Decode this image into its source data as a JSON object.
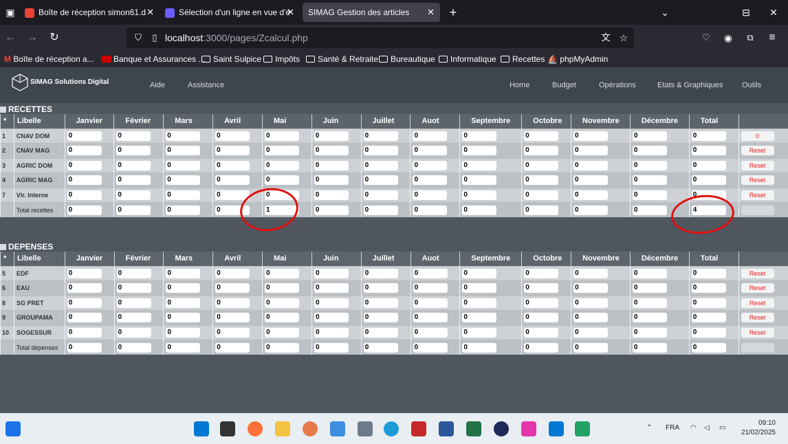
{
  "browser": {
    "tabs": [
      {
        "label": "Boîte de réception    simon61.d",
        "active": false
      },
      {
        "label": "Sélection d'un ligne en vue d'é",
        "active": false
      },
      {
        "label": "SIMAG Gestion des articles",
        "active": true
      }
    ],
    "url_host": "localhost",
    "url_path": ":3000/pages/Zcalcul.php",
    "bookmarks": [
      "Boîte de réception",
      "a...",
      "Banque et Assurances ...",
      "Saint Sulpice",
      "Impôts",
      "Santé & Retraite",
      "Bureautique",
      "Informatique",
      "Recettes",
      "phpMyAdmin"
    ]
  },
  "app": {
    "brand": "SIMAG Solutions Digital",
    "menu_left": [
      "Aide",
      "Assistance"
    ],
    "menu_right": [
      "Home",
      "Budget",
      "Opérations",
      "Etats & Graphiques",
      "Outils"
    ]
  },
  "columns": [
    "*",
    "Libelle",
    "Janvier",
    "Février",
    "Mars",
    "Avril",
    "Mai",
    "Juin",
    "Juillet",
    "Auot",
    "Septembre",
    "Octobre",
    "Novembre",
    "Décembre",
    "Total",
    ""
  ],
  "recettes": {
    "title": "RECETTES",
    "rows": [
      {
        "num": "1",
        "label": "CNAV DOM",
        "values": [
          "0",
          "0",
          "0",
          "0",
          "0",
          "0",
          "0",
          "0",
          "0",
          "0",
          "0",
          "0",
          "0"
        ],
        "action": "0"
      },
      {
        "num": "2",
        "label": "CNAV MAG",
        "values": [
          "0",
          "0",
          "0",
          "0",
          "0",
          "0",
          "0",
          "0",
          "0",
          "0",
          "0",
          "0",
          "0"
        ],
        "action": "Reset"
      },
      {
        "num": "3",
        "label": "AGRIC DOM",
        "values": [
          "0",
          "0",
          "0",
          "0",
          "0",
          "0",
          "0",
          "0",
          "0",
          "0",
          "0",
          "0",
          "0"
        ],
        "action": "Reset"
      },
      {
        "num": "4",
        "label": "AGRIC MAG",
        "values": [
          "0",
          "0",
          "0",
          "0",
          "0",
          "0",
          "0",
          "0",
          "0",
          "0",
          "0",
          "0",
          "0"
        ],
        "action": "Reset"
      },
      {
        "num": "7",
        "label": "Vir. Interne",
        "values": [
          "0",
          "0",
          "0",
          "0",
          "0",
          "0",
          "0",
          "0",
          "0",
          "0",
          "0",
          "0",
          "0"
        ],
        "action": "Reset"
      },
      {
        "num": "",
        "label": "Total recettes",
        "values": [
          "0",
          "0",
          "0",
          "0",
          "1",
          "0",
          "0",
          "0",
          "0",
          "0",
          "0",
          "0",
          "4"
        ],
        "action": ""
      }
    ]
  },
  "depenses": {
    "title": "DEPENSES",
    "rows": [
      {
        "num": "5",
        "label": "EDF",
        "values": [
          "0",
          "0",
          "0",
          "0",
          "0",
          "0",
          "0",
          "0",
          "0",
          "0",
          "0",
          "0",
          "0"
        ],
        "action": "Reset"
      },
      {
        "num": "6",
        "label": "EAU",
        "values": [
          "0",
          "0",
          "0",
          "0",
          "0",
          "0",
          "0",
          "0",
          "0",
          "0",
          "0",
          "0",
          "0"
        ],
        "action": "Reset"
      },
      {
        "num": "8",
        "label": "SG PRET",
        "values": [
          "0",
          "0",
          "0",
          "0",
          "0",
          "0",
          "0",
          "0",
          "0",
          "0",
          "0",
          "0",
          "0"
        ],
        "action": "Reset"
      },
      {
        "num": "9",
        "label": "GROUPAMA",
        "values": [
          "0",
          "0",
          "0",
          "0",
          "0",
          "0",
          "0",
          "0",
          "0",
          "0",
          "0",
          "0",
          "0"
        ],
        "action": "Reset"
      },
      {
        "num": "10",
        "label": "SOGESSUR",
        "values": [
          "0",
          "0",
          "0",
          "0",
          "0",
          "0",
          "0",
          "0",
          "0",
          "0",
          "0",
          "0",
          "0"
        ],
        "action": "Reset"
      },
      {
        "num": "",
        "label": "Total dépenses",
        "values": [
          "0",
          "0",
          "0",
          "0",
          "0",
          "0",
          "0",
          "0",
          "0",
          "0",
          "0",
          "0",
          "0"
        ],
        "action": ""
      }
    ]
  },
  "taskbar": {
    "lang": "FRA",
    "time": "09:10",
    "date": "21/02/2025"
  },
  "colors": {
    "annotation": "#e01010",
    "reset_text": "#e02020"
  }
}
